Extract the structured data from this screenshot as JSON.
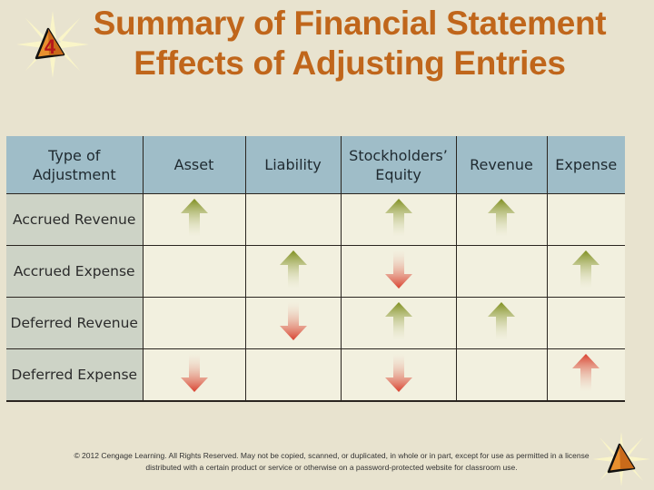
{
  "slide": {
    "badge_number": "4",
    "title_line1": "Summary of Financial Statement",
    "title_line2": "Effects of Adjusting Entries"
  },
  "table": {
    "headers": [
      "Type of Adjustment",
      "Asset",
      "Liability",
      "Stockholders’ Equity",
      "Revenue",
      "Expense"
    ],
    "header_lines": {
      "type": [
        "Type of",
        "Adjustment"
      ],
      "equity": [
        "Stockholders’",
        "Equity"
      ]
    },
    "rows": [
      {
        "label": "Accrued Revenue",
        "effects": [
          "increase",
          "none",
          "increase",
          "increase",
          "none"
        ]
      },
      {
        "label": "Accrued Expense",
        "effects": [
          "none",
          "increase",
          "decrease",
          "none",
          "increase"
        ]
      },
      {
        "label": "Deferred Revenue",
        "effects": [
          "none",
          "decrease",
          "increase",
          "increase",
          "none"
        ]
      },
      {
        "label": "Deferred Expense",
        "effects": [
          "decrease",
          "none",
          "decrease",
          "none",
          "increase-red"
        ]
      }
    ],
    "icons": {
      "increase": "green-up-arrow-icon",
      "decrease": "red-down-arrow-icon",
      "increase-red": "red-up-arrow-icon"
    },
    "colors": {
      "green": "#8a9a2a",
      "red": "#d9412e",
      "header_bg": "#9fbdc8",
      "label_bg": "#cdd3c6",
      "cell_bg": "#f2f0df",
      "title": "#c0661b"
    }
  },
  "footer": {
    "line1": "© 2012 Cengage Learning. All Rights Reserved. May not be copied, scanned, or duplicated, in whole or in part, except for use as permitted in a license",
    "line2": "distributed with a certain product or service or otherwise on a password-protected website for classroom use."
  }
}
